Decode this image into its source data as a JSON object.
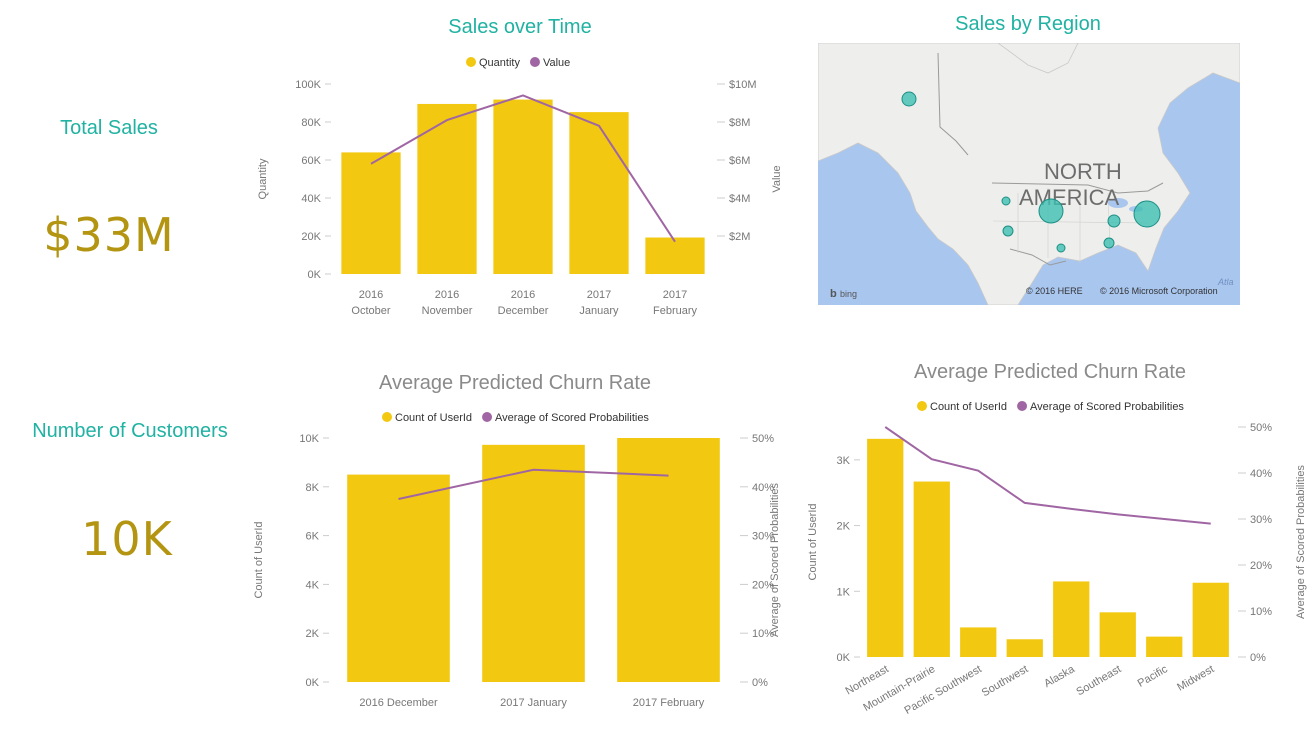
{
  "colors": {
    "bar": "#f2c811",
    "line": "#a066a3",
    "teal": "#20b2a2",
    "gold": "#b49512",
    "axis_text": "#777777",
    "water": "#a9c6ef",
    "land": "#eeeeec",
    "bubble": "#3fbfb3"
  },
  "cards": [
    {
      "title": "Total Sales",
      "value": "$33M"
    },
    {
      "title": "Number of Customers",
      "value": "10K"
    }
  ],
  "map": {
    "title": "Sales by Region",
    "label_line1": "NORTH",
    "label_line2": "AMERICA",
    "bing": "bing",
    "copyright_here": "© 2016 HERE",
    "copyright_ms": "© 2016 Microsoft Corporation",
    "ocean_label": "Atla"
  },
  "chart_data": [
    {
      "type": "bar",
      "title": "Sales over Time",
      "categories": [
        [
          "2016",
          "October"
        ],
        [
          "2016",
          "November"
        ],
        [
          "2016",
          "December"
        ],
        [
          "2017",
          "January"
        ],
        [
          "2017",
          "February"
        ]
      ],
      "series": [
        {
          "name": "Quantity",
          "type": "bar",
          "axis": "left",
          "values": [
            64000,
            89500,
            91800,
            85200,
            19200
          ]
        },
        {
          "name": "Value",
          "type": "line",
          "axis": "right",
          "values": [
            5.8,
            8.1,
            9.4,
            7.8,
            1.7
          ]
        }
      ],
      "ylabel": "Quantity",
      "y2label": "Value",
      "ylim": [
        0,
        100000
      ],
      "y2lim": [
        0,
        10
      ],
      "yticks": [
        "0K",
        "20K",
        "40K",
        "60K",
        "80K",
        "100K"
      ],
      "y2ticks": [
        "$2M",
        "$4M",
        "$6M",
        "$8M",
        "$10M"
      ],
      "legend": "top"
    },
    {
      "type": "bar",
      "title": "Average Predicted Churn Rate",
      "categories": [
        [
          "2016 December"
        ],
        [
          "2017 January"
        ],
        [
          "2017 February"
        ]
      ],
      "series": [
        {
          "name": "Count of UserId",
          "type": "bar",
          "axis": "left",
          "values": [
            8500,
            9720,
            10000
          ]
        },
        {
          "name": "Average of Scored Probabilities",
          "type": "line",
          "axis": "right",
          "values": [
            37.5,
            43.5,
            42.3
          ]
        }
      ],
      "ylabel": "Count of UserId",
      "y2label": "Average of Scored Probabilities",
      "ylim": [
        0,
        10000
      ],
      "y2lim": [
        0,
        50
      ],
      "yticks": [
        "0K",
        "2K",
        "4K",
        "6K",
        "8K",
        "10K"
      ],
      "y2ticks": [
        "0%",
        "10%",
        "20%",
        "30%",
        "40%",
        "50%"
      ],
      "legend": "top"
    },
    {
      "type": "bar",
      "title": "Average Predicted Churn Rate",
      "categories": [
        [
          "Northeast"
        ],
        [
          "Mountain-Prairie"
        ],
        [
          "Pacific Southwest"
        ],
        [
          "Southwest"
        ],
        [
          "Alaska"
        ],
        [
          "Southeast"
        ],
        [
          "Pacific"
        ],
        [
          "Midwest"
        ]
      ],
      "series": [
        {
          "name": "Count of UserId",
          "type": "bar",
          "axis": "left",
          "values": [
            3320,
            2670,
            450,
            270,
            1150,
            680,
            310,
            1130
          ]
        },
        {
          "name": "Average of Scored Probabilities",
          "type": "line",
          "axis": "right",
          "values": [
            50,
            43,
            40.5,
            33.5,
            32.2,
            31,
            30,
            29
          ]
        }
      ],
      "ylabel": "Count of UserId",
      "y2label": "Average of Scored Probabilities",
      "ylim": [
        0,
        3500
      ],
      "y2lim": [
        0,
        50
      ],
      "yticks": [
        "0K",
        "1K",
        "2K",
        "3K"
      ],
      "ytick_values": [
        0,
        1000,
        2000,
        3000
      ],
      "y2ticks": [
        "0%",
        "10%",
        "20%",
        "30%",
        "40%",
        "50%"
      ],
      "legend": "top",
      "rotated_labels": true
    }
  ]
}
